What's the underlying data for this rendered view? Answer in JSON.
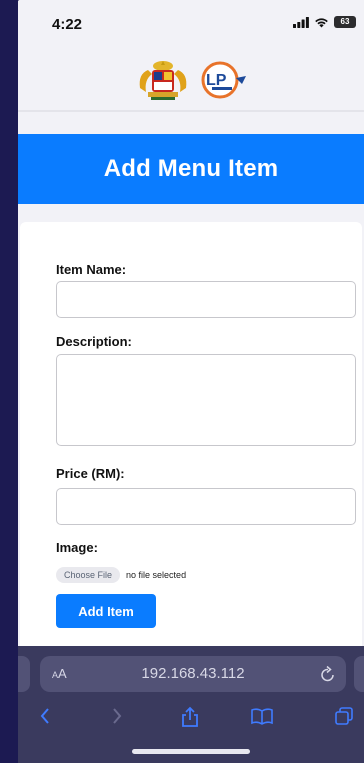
{
  "status_bar": {
    "time": "4:22",
    "battery": "63",
    "icons": [
      "signal-icon",
      "wifi-icon",
      "battery-icon"
    ]
  },
  "logos": [
    "malaysia-coat-of-arms-logo",
    "lp-logo"
  ],
  "header": {
    "title": "Add Menu Item",
    "color": "#0a7cff"
  },
  "form": {
    "item_name_label": "Item Name:",
    "item_name_value": "",
    "description_label": "Description:",
    "description_value": "",
    "price_label": "Price (RM):",
    "price_value": "",
    "image_label": "Image:",
    "choose_file_label": "Choose File",
    "file_status": "no file selected",
    "submit_label": "Add Item"
  },
  "browser": {
    "text_size_label": "AA",
    "url": "192.168.43.112",
    "toolbar_icons": [
      "back-icon",
      "forward-icon",
      "share-icon",
      "bookmarks-icon",
      "tabs-icon"
    ]
  }
}
